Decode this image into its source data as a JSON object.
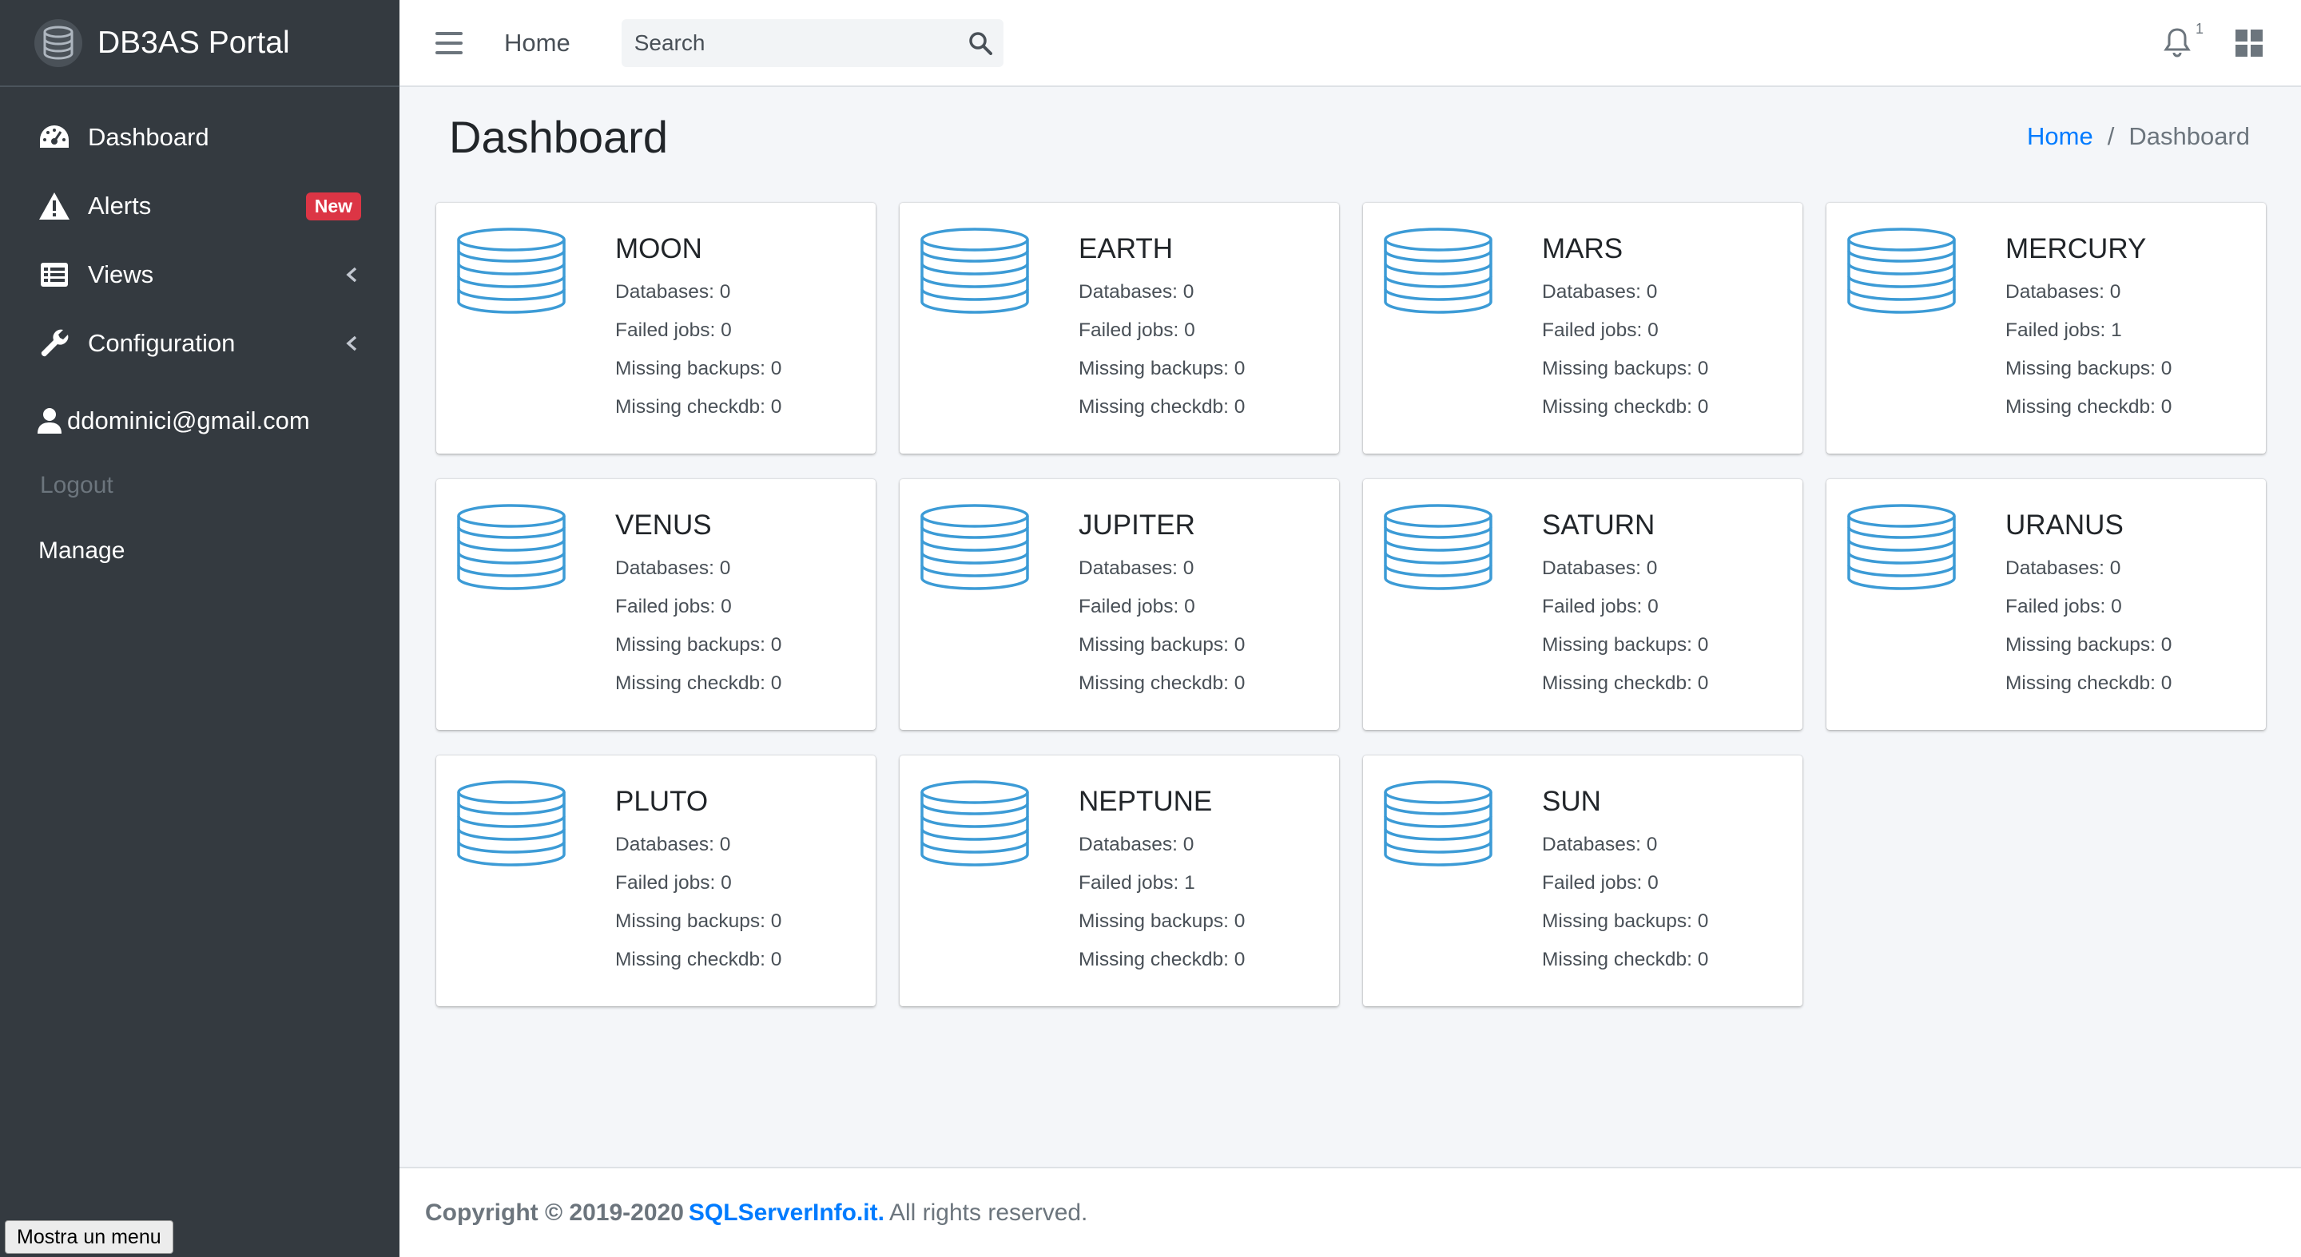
{
  "app": {
    "title": "DB3AS Portal"
  },
  "sidebar": {
    "items": [
      {
        "label": "Dashboard",
        "icon": "tachometer-icon"
      },
      {
        "label": "Alerts",
        "icon": "warning-icon",
        "badge": "New"
      },
      {
        "label": "Views",
        "icon": "list-icon"
      },
      {
        "label": "Configuration",
        "icon": "wrench-icon"
      }
    ],
    "user_email": "ddominici@gmail.com",
    "logout": "Logout",
    "manage": "Manage",
    "tooltip": "Mostra un menu"
  },
  "topbar": {
    "home": "Home",
    "search_placeholder": "Search",
    "notification_count": "1"
  },
  "page": {
    "title": "Dashboard",
    "breadcrumb": {
      "home": "Home",
      "separator": "/",
      "current": "Dashboard"
    }
  },
  "servers": [
    {
      "name": "MOON",
      "databases": "Databases: 0",
      "failed": "Failed jobs: 0",
      "backups": "Missing backups: 0",
      "checkdb": "Missing checkdb: 0"
    },
    {
      "name": "EARTH",
      "databases": "Databases: 0",
      "failed": "Failed jobs: 0",
      "backups": "Missing backups: 0",
      "checkdb": "Missing checkdb: 0"
    },
    {
      "name": "MARS",
      "databases": "Databases: 0",
      "failed": "Failed jobs: 0",
      "backups": "Missing backups: 0",
      "checkdb": "Missing checkdb: 0"
    },
    {
      "name": "MERCURY",
      "databases": "Databases: 0",
      "failed": "Failed jobs: 1",
      "backups": "Missing backups: 0",
      "checkdb": "Missing checkdb: 0"
    },
    {
      "name": "VENUS",
      "databases": "Databases: 0",
      "failed": "Failed jobs: 0",
      "backups": "Missing backups: 0",
      "checkdb": "Missing checkdb: 0"
    },
    {
      "name": "JUPITER",
      "databases": "Databases: 0",
      "failed": "Failed jobs: 0",
      "backups": "Missing backups: 0",
      "checkdb": "Missing checkdb: 0"
    },
    {
      "name": "SATURN",
      "databases": "Databases: 0",
      "failed": "Failed jobs: 0",
      "backups": "Missing backups: 0",
      "checkdb": "Missing checkdb: 0"
    },
    {
      "name": "URANUS",
      "databases": "Databases: 0",
      "failed": "Failed jobs: 0",
      "backups": "Missing backups: 0",
      "checkdb": "Missing checkdb: 0"
    },
    {
      "name": "PLUTO",
      "databases": "Databases: 0",
      "failed": "Failed jobs: 0",
      "backups": "Missing backups: 0",
      "checkdb": "Missing checkdb: 0"
    },
    {
      "name": "NEPTUNE",
      "databases": "Databases: 0",
      "failed": "Failed jobs: 1",
      "backups": "Missing backups: 0",
      "checkdb": "Missing checkdb: 0"
    },
    {
      "name": "SUN",
      "databases": "Databases: 0",
      "failed": "Failed jobs: 0",
      "backups": "Missing backups: 0",
      "checkdb": "Missing checkdb: 0"
    }
  ],
  "footer": {
    "copyright": "Copyright © 2019-2020",
    "link": "SQLServerInfo.it.",
    "rights": "All rights reserved."
  },
  "colors": {
    "sidebar_bg": "#343a40",
    "accent": "#007bff",
    "badge": "#dc3545",
    "db_icon": "#3c9bd6"
  }
}
